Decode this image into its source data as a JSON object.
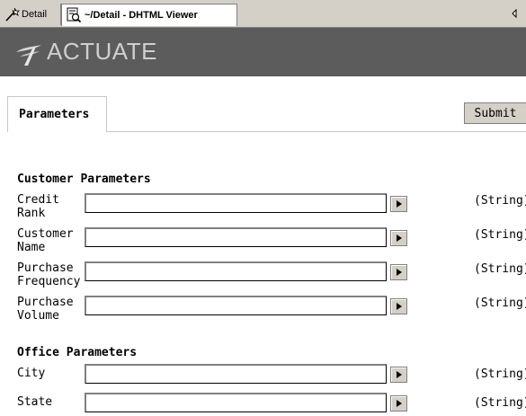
{
  "tabs": {
    "detail_label": "Detail",
    "viewer_label": "~/Detail - DHTML Viewer"
  },
  "banner": {
    "logo_text": "ACTUATE"
  },
  "params_tab": {
    "label": "Parameters",
    "submit_label": "Submit"
  },
  "sections": [
    {
      "title": "Customer Parameters",
      "fields": [
        {
          "label_line1": "Credit",
          "label_line2": "Rank",
          "value": "",
          "type": "(String)"
        },
        {
          "label_line1": "Customer",
          "label_line2": "Name",
          "value": "",
          "type": "(String)"
        },
        {
          "label_line1": "Purchase",
          "label_line2": "Frequency",
          "value": "",
          "type": "(String)"
        },
        {
          "label_line1": "Purchase",
          "label_line2": "Volume",
          "value": "",
          "type": "(String)"
        }
      ]
    },
    {
      "title": "Office Parameters",
      "fields": [
        {
          "label_line1": "City",
          "label_line2": "",
          "value": "",
          "type": "(String)"
        },
        {
          "label_line1": "State",
          "label_line2": "",
          "value": "",
          "type": "(String)"
        }
      ]
    }
  ]
}
